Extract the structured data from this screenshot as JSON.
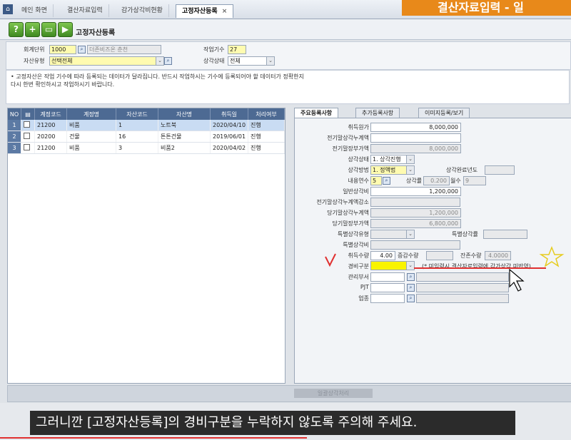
{
  "tabs": [
    {
      "label": "메인 화면"
    },
    {
      "label": "결산자료입력"
    },
    {
      "label": "감가상각비현황"
    },
    {
      "label": "고정자산등록",
      "active": true
    }
  ],
  "tab_close": "×",
  "banner": "결산자료입력 - 일",
  "toolbar": {
    "buttons": [
      "?",
      "+",
      "▭",
      "▶"
    ]
  },
  "page_title": "고정자산등록",
  "filter": {
    "unit_label": "회계단위",
    "unit_code": "1000",
    "unit_name": "더존비즈온 춘천",
    "asset_type_label": "자산유형",
    "asset_type_value": "선택전체",
    "period_label": "작업기수",
    "period_value": "27",
    "status_label": "상각상태",
    "status_value": "전체"
  },
  "notice": [
    "• 고정자산은 작업 기수에 따라 등록되는 데이터가 달라집니다. 반드시 작업하시는 기수에 등록되어야 할 데이터가 정확한지",
    "  다시 한번 확인하시고 작업하시기 바랍니다."
  ],
  "table": {
    "headers": [
      "NO",
      "",
      "계정코드",
      "계정명",
      "자산코드",
      "자산명",
      "취득일",
      "처리여부"
    ],
    "rows": [
      {
        "no": "1",
        "account_code": "21200",
        "account_name": "비품",
        "asset_code": "1",
        "asset_name": "노트북",
        "date": "2020/04/10",
        "status": "진행"
      },
      {
        "no": "2",
        "account_code": "20200",
        "account_name": "건물",
        "asset_code": "16",
        "asset_name": "튼튼건물",
        "date": "2019/06/01",
        "status": "진행"
      },
      {
        "no": "3",
        "account_code": "21200",
        "account_name": "비품",
        "asset_code": "3",
        "asset_name": "비품2",
        "date": "2020/04/02",
        "status": "진행"
      }
    ]
  },
  "right_tabs": [
    "주요등록사항",
    "추가등록사항",
    "이미지등록/보기"
  ],
  "form": {
    "acq_cost_label": "취득원가",
    "acq_cost": "8,000,000",
    "prev_accum_label": "전기말상각누계액",
    "prev_accum": "",
    "prev_book_label": "전기말장부가액",
    "prev_book": "8,000,000",
    "dep_status_label": "상각상태",
    "dep_status": "1. 상각진행",
    "dep_method_label": "상각방법",
    "dep_method": "1. 정액법",
    "dep_done_year_label": "상각완료년도",
    "life_label": "내용연수",
    "life": "5",
    "rate_label": "상각률",
    "rate": "0.200",
    "months_label": "월수",
    "months": "9",
    "general_dep_label": "일반상각비",
    "general_dep": "1,200,000",
    "prev_accum_dec_label": "전기말상각누계액감소",
    "curr_accum_label": "당기말상각누계액",
    "curr_accum": "1,200,000",
    "curr_book_label": "당기말장부가액",
    "curr_book": "6,800,000",
    "special_type_label": "특별상각유형",
    "special_rate_label": "특별상각률",
    "special_dep_label": "특별상각비",
    "acq_qty_label": "취득수량",
    "acq_qty": "4.00",
    "change_qty_label": "증감수량",
    "remain_qty_label": "잔존수량",
    "remain_qty": "4.0000",
    "expense_label": "경비구분",
    "expense_hint": "(* 미입력시 결산자료입력에 감가상각 미반영)",
    "dept_label": "관리부서",
    "pjt_label": "PJT",
    "industry_label": "업종"
  },
  "bottom_button": "일괄상각처리",
  "subtitle": "그러니깐 [고정자산등록]의 경비구분을 누락하지 않도록 주의해 주세요.",
  "colors": {
    "banner": "#e8891a",
    "header_blue": "#4d6a93",
    "highlight_yellow": "#f9f400",
    "annotation_red": "#e03030"
  }
}
